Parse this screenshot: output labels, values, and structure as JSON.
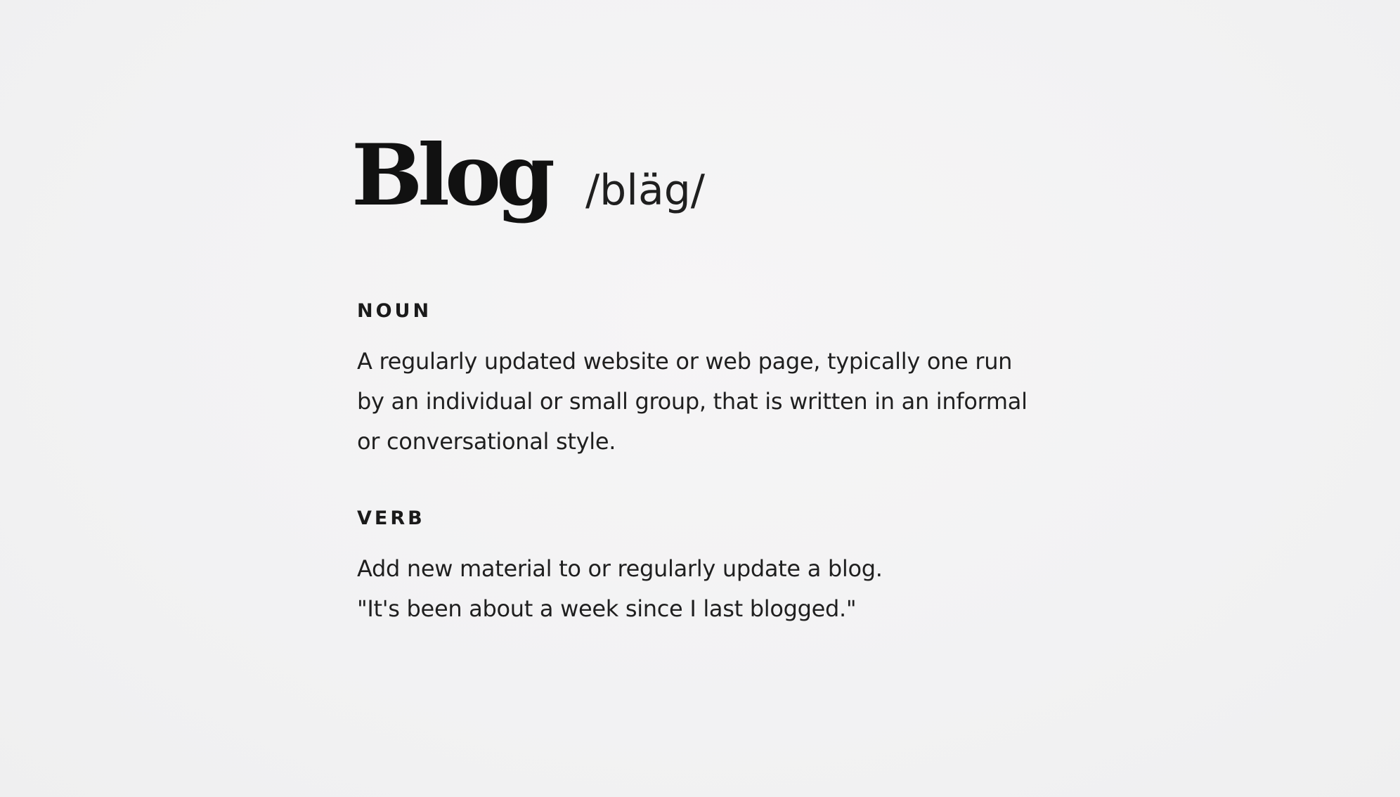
{
  "entry": {
    "word": "Blog",
    "pronunciation": "/bläg/"
  },
  "noun": {
    "label": "NOUN",
    "definition_lines": [
      "A regularly updated website or web page, typically one run",
      "by an individual or small group, that is written in an informal",
      "or conversational style."
    ]
  },
  "verb": {
    "label": "VERB",
    "definition": "Add new material to or regularly update a blog.",
    "example": "\"It's been about a week since I last blogged.\""
  }
}
